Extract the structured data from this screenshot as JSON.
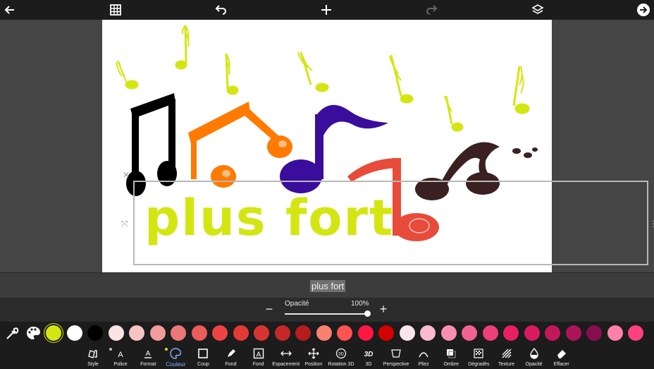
{
  "toolbar": {
    "back_icon": "arrow-left-icon",
    "grid_icon": "grid-icon",
    "undo_icon": "undo-icon",
    "add_icon": "plus-icon",
    "redo_icon": "redo-icon",
    "layers_icon": "layers-icon",
    "next_icon": "arrow-right-circle-icon"
  },
  "canvas": {
    "text": "plus fort",
    "text_color": "#d4e612",
    "note_colors": [
      "#000000",
      "#ff7a00",
      "#3a0d9c",
      "#e84b3a",
      "#3a2020",
      "#d4e612"
    ]
  },
  "text_input": {
    "value": "plus fort"
  },
  "opacity": {
    "label": "Opacité",
    "value": "100%",
    "level": 1.0,
    "minus": "−",
    "plus": "+"
  },
  "palette": {
    "eyedropper_icon": "eyedropper-icon",
    "palette_icon": "palette-icon",
    "selected_color": "#d4e612",
    "swatches": [
      "#d4e612",
      "#ffffff",
      "#000000",
      "#fbe3e3",
      "#f7c4c4",
      "#f29b9b",
      "#ec7777",
      "#ea5b5b",
      "#ef4444",
      "#e53935",
      "#d93434",
      "#c62828",
      "#b71c1c",
      "#fa8072",
      "#ff5252",
      "#ff1744",
      "#d50000",
      "#fce4ec",
      "#f8bbd0",
      "#f48fb1",
      "#f06292",
      "#ec407a",
      "#e91e63",
      "#d81b60",
      "#c2185b",
      "#ad1457",
      "#880e4f",
      "#ff80ab",
      "#ff4081"
    ]
  },
  "tools": [
    {
      "label": "Style",
      "icon": "style-icon"
    },
    {
      "label": "Police",
      "icon": "font-icon"
    },
    {
      "label": "Format",
      "icon": "format-icon"
    },
    {
      "label": "Couleur",
      "icon": "palette-icon",
      "active": true
    },
    {
      "label": "Coup",
      "icon": "stroke-icon"
    },
    {
      "label": "Fond",
      "icon": "highlighter-icon"
    },
    {
      "label": "Fond",
      "icon": "text-background-icon"
    },
    {
      "label": "Espacement",
      "icon": "spacing-icon"
    },
    {
      "label": "Position",
      "icon": "move-icon"
    },
    {
      "label": "Rotation 3D",
      "icon": "rotate-3d-icon"
    },
    {
      "label": "3D",
      "icon": "3d-icon"
    },
    {
      "label": "Perspective",
      "icon": "perspective-icon"
    },
    {
      "label": "Pliez",
      "icon": "curve-icon"
    },
    {
      "label": "Ombre",
      "icon": "shadow-icon"
    },
    {
      "label": "Dégradés",
      "icon": "gradient-icon"
    },
    {
      "label": "Texture",
      "icon": "texture-icon"
    },
    {
      "label": "Opacité",
      "icon": "opacity-drop-icon"
    },
    {
      "label": "Effacer",
      "icon": "eraser-icon"
    }
  ]
}
